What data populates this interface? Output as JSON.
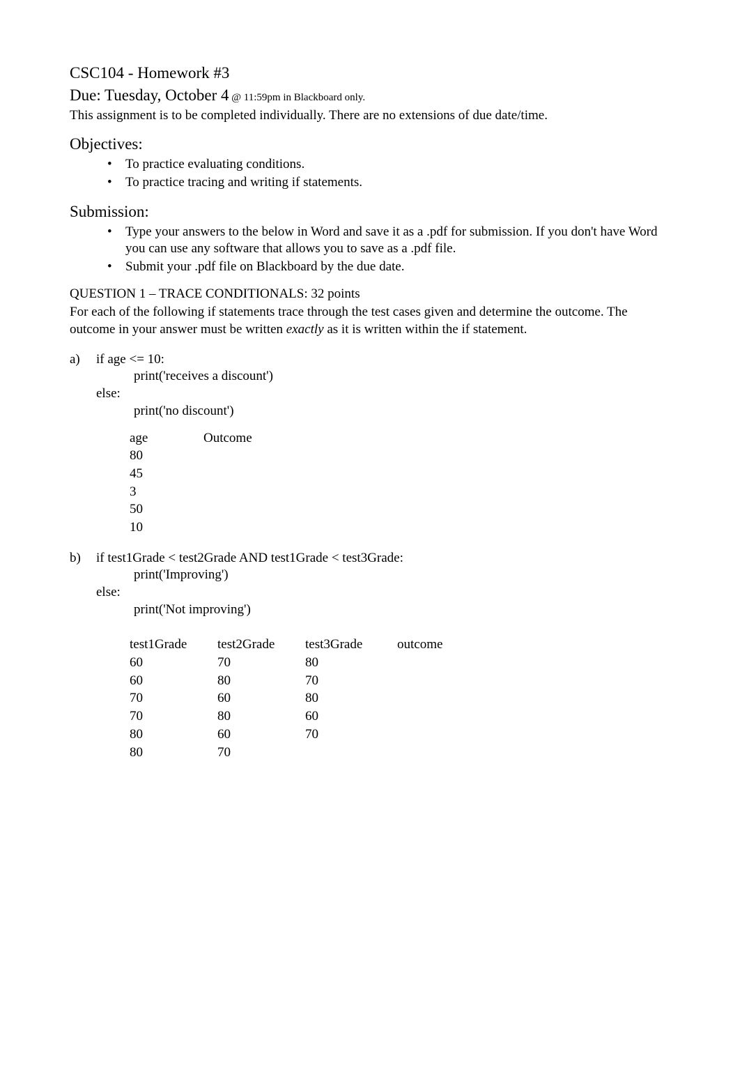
{
  "header": {
    "title": "CSC104 - Homework #3",
    "due_prefix": "Due: Tuesday, October 4",
    "due_suffix": " @ 11:59pm in Blackboard only.",
    "note": "This assignment is to be completed individually. There are no extensions of due date/time."
  },
  "objectives": {
    "heading": "Objectives:",
    "items": [
      "To practice evaluating conditions.",
      "To practice tracing and writing if statements."
    ]
  },
  "submission": {
    "heading": "Submission:",
    "items": [
      "Type your answers to the below in Word and save it as a .pdf for submission.   If you don't have Word you can use any software that allows you to save as a .pdf file.",
      "Submit your .pdf file on Blackboard by the due date."
    ]
  },
  "question1": {
    "heading": "QUESTION 1  – TRACE CONDITIONALS: 32 points",
    "body_pre": "For each of the following if statements trace through the test cases given and determine the outcome. The outcome in your answer must be written ",
    "body_em": "exactly ",
    "body_post": "as it is written within the if statement."
  },
  "part_a": {
    "letter": "a)",
    "line1": "if age <= 10:",
    "line2": "print('receives a discount')",
    "line3": "else:",
    "line4": "print('no discount')",
    "headers": {
      "age": "age",
      "outcome": "Outcome"
    },
    "rows": [
      {
        "age": "80",
        "outcome": ""
      },
      {
        "age": "45",
        "outcome": ""
      },
      {
        "age": "3",
        "outcome": ""
      },
      {
        "age": "50",
        "outcome": ""
      },
      {
        "age": "10",
        "outcome": ""
      }
    ]
  },
  "part_b": {
    "letter": "b)",
    "line1": "if test1Grade < test2Grade AND test1Grade < test3Grade:",
    "line2": "print('Improving')",
    "line3": "else:",
    "line4": "print('Not improving')",
    "headers": {
      "t1": "test1Grade",
      "t2": "test2Grade",
      "t3": "test3Grade",
      "out": "outcome"
    },
    "rows": [
      {
        "t1": "60",
        "t2": "70",
        "t3": "80",
        "out": ""
      },
      {
        "t1": "60",
        "t2": "80",
        "t3": "70",
        "out": ""
      },
      {
        "t1": "70",
        "t2": "60",
        "t3": "80",
        "out": ""
      },
      {
        "t1": "70",
        "t2": "80",
        "t3": "60",
        "out": ""
      },
      {
        "t1": "80",
        "t2": "60",
        "t3": "70",
        "out": ""
      },
      {
        "t1": "80",
        "t2": "70",
        "t3": "",
        "out": ""
      }
    ]
  }
}
